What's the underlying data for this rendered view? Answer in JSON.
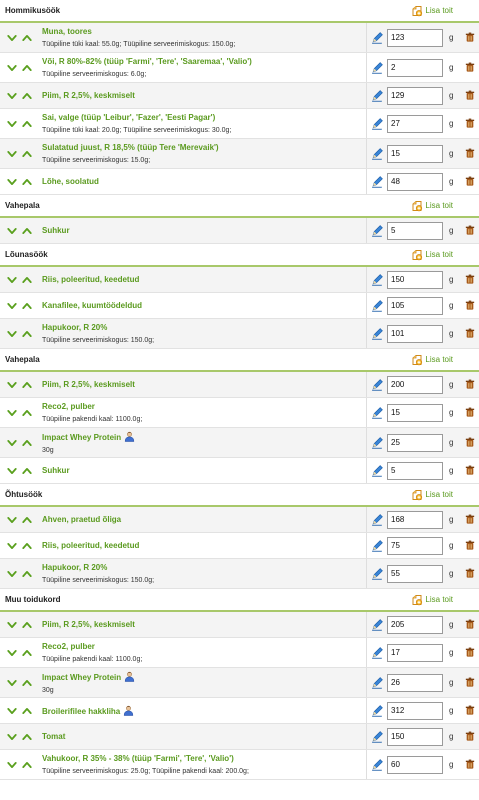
{
  "add_label": "Lisa toit",
  "unit": "g",
  "meals": [
    {
      "title": "Hommikusöök",
      "items": [
        {
          "name": "Muna, toores",
          "desc": "Tüüpiline tüki kaal: 55.0g; Tüüpiline serveerimiskogus: 150.0g;",
          "qty": "123"
        },
        {
          "name": "Või, R 80%-82% (tüüp 'Farmi', 'Tere', 'Saaremaa', 'Valio')",
          "desc": "Tüüpiline serveerimiskogus: 6.0g;",
          "qty": "2"
        },
        {
          "name": "Piim, R 2,5%, keskmiselt",
          "desc": "",
          "qty": "129"
        },
        {
          "name": "Sai, valge (tüüp 'Leibur', 'Fazer', 'Eesti Pagar')",
          "desc": "Tüüpiline tüki kaal: 20.0g; Tüüpiline serveerimiskogus: 30.0g;",
          "qty": "27"
        },
        {
          "name": "Sulatatud juust, R 18,5% (tüüp Tere 'Merevaik')",
          "desc": "Tüüpiline serveerimiskogus: 15.0g;",
          "qty": "15"
        },
        {
          "name": "Lõhe, soolatud",
          "desc": "",
          "qty": "48"
        }
      ]
    },
    {
      "title": "Vahepala",
      "items": [
        {
          "name": "Suhkur",
          "desc": "",
          "qty": "5"
        }
      ]
    },
    {
      "title": "Lõunasöök",
      "items": [
        {
          "name": "Riis, poleeritud, keedetud",
          "desc": "",
          "qty": "150"
        },
        {
          "name": "Kanafilee, kuumtöödeldud",
          "desc": "",
          "qty": "105"
        },
        {
          "name": "Hapukoor, R 20%",
          "desc": "Tüüpiline serveerimiskogus: 150.0g;",
          "qty": "101"
        }
      ]
    },
    {
      "title": "Vahepala",
      "items": [
        {
          "name": "Piim, R 2,5%, keskmiselt",
          "desc": "",
          "qty": "200"
        },
        {
          "name": "Reco2, pulber",
          "desc": "Tüüpiline pakendi kaal: 1100.0g;",
          "qty": "15"
        },
        {
          "name": "Impact Whey Protein",
          "desc": "30g",
          "qty": "25",
          "user": true
        },
        {
          "name": "Suhkur",
          "desc": "",
          "qty": "5"
        }
      ]
    },
    {
      "title": "Õhtusöök",
      "items": [
        {
          "name": "Ahven, praetud õliga",
          "desc": "",
          "qty": "168"
        },
        {
          "name": "Riis, poleeritud, keedetud",
          "desc": "",
          "qty": "75"
        },
        {
          "name": "Hapukoor, R 20%",
          "desc": "Tüüpiline serveerimiskogus: 150.0g;",
          "qty": "55"
        }
      ]
    },
    {
      "title": "Muu toidukord",
      "items": [
        {
          "name": "Piim, R 2,5%, keskmiselt",
          "desc": "",
          "qty": "205"
        },
        {
          "name": "Reco2, pulber",
          "desc": "Tüüpiline pakendi kaal: 1100.0g;",
          "qty": "17"
        },
        {
          "name": "Impact Whey Protein",
          "desc": "30g",
          "qty": "26",
          "user": true
        },
        {
          "name": "Broilerifilee hakkliha",
          "desc": "",
          "qty": "312",
          "user": true
        },
        {
          "name": "Tomat",
          "desc": "",
          "qty": "150"
        },
        {
          "name": "Vahukoor, R 35% - 38% (tüüp 'Farmi', 'Tere', 'Valio')",
          "desc": "Tüüpiline serveerimiskogus: 25.0g; Tüüpiline pakendi kaal: 200.0g;",
          "qty": "60"
        }
      ]
    }
  ],
  "colors": {
    "accent": "#5a9a1e",
    "header_rule": "#a8c86a",
    "row_bg": "#f4f4f4"
  }
}
